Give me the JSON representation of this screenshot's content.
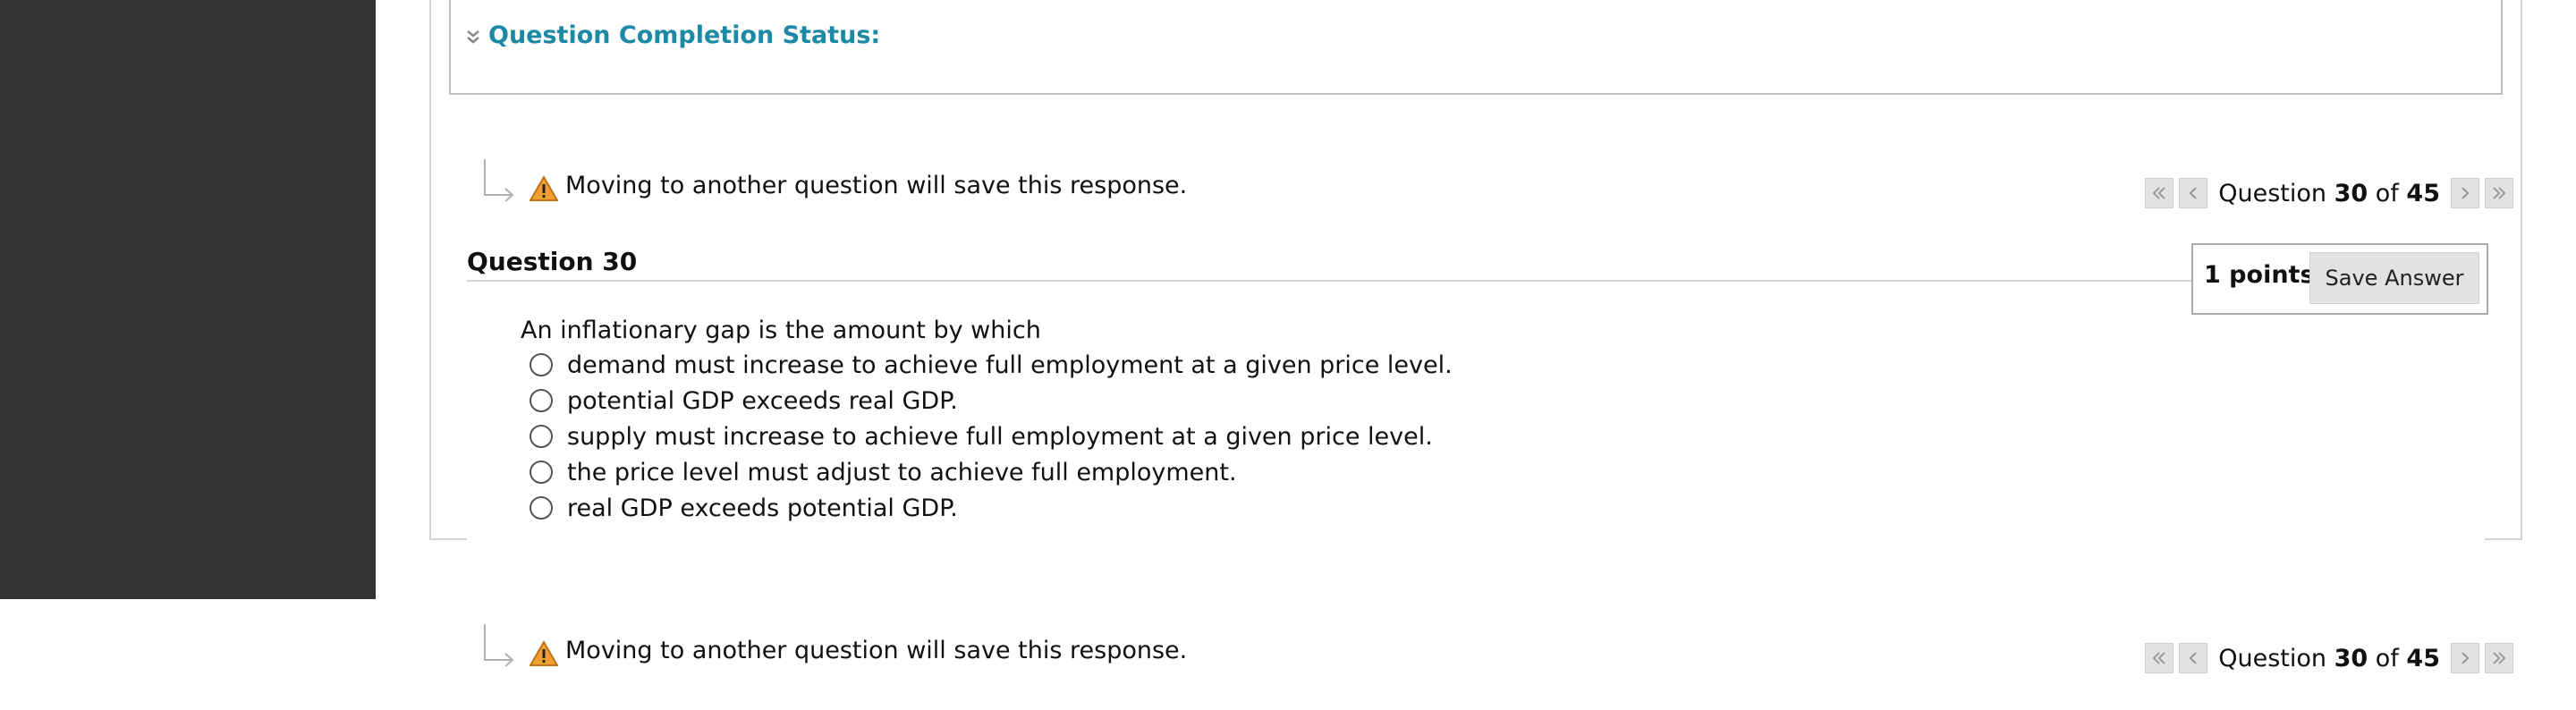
{
  "status": {
    "title": "Question Completion Status:"
  },
  "nav": {
    "warning": "Moving to another question will save this response.",
    "question_word": "Question",
    "current": "30",
    "of_word": "of",
    "total": "45"
  },
  "question": {
    "title": "Question 30",
    "points": "1 points",
    "save_label": "Save Answer",
    "prompt": "An inflationary gap is the amount by which",
    "options": [
      "demand must increase to achieve full employment at a given price level.",
      "potential GDP exceeds real GDP.",
      "supply must increase to achieve full employment at a given price level.",
      "the price level must adjust to achieve full employment.",
      "real GDP exceeds potential GDP."
    ]
  },
  "colors": {
    "left_rail": "#333333",
    "status_title": "#1c8aa5",
    "warning_fill": "#f0a030"
  }
}
